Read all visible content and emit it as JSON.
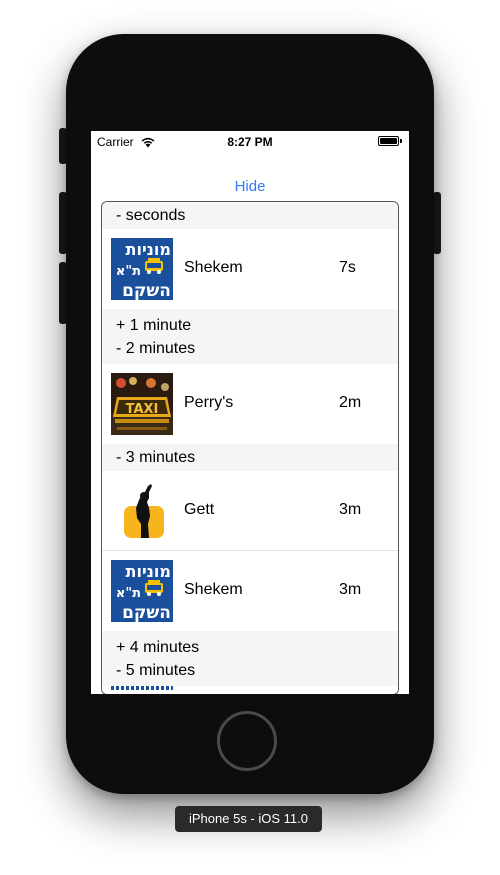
{
  "status_bar": {
    "carrier": "Carrier",
    "time": "8:27 PM",
    "icons": [
      "wifi-icon",
      "battery-icon"
    ]
  },
  "hide_button": "Hide",
  "colors": {
    "accent": "#3478f6",
    "section_bg": "#f5f5f5",
    "shekem_blue": "#1a4f9c",
    "gett_yellow": "#f6b51d"
  },
  "sections": [
    {
      "header": "- seconds",
      "expanded": true,
      "rows": [
        {
          "name": "Shekem",
          "time": "7s",
          "logo": "shekem-logo"
        }
      ]
    },
    {
      "header": "+ 1 minute",
      "expanded": false,
      "rows": []
    },
    {
      "header": "- 2 minutes",
      "expanded": true,
      "rows": [
        {
          "name": "Perry's",
          "time": "2m",
          "logo": "taxi-sign-logo"
        }
      ]
    },
    {
      "header": "- 3 minutes",
      "expanded": true,
      "rows": [
        {
          "name": "Gett",
          "time": "3m",
          "logo": "gett-logo"
        },
        {
          "name": "Shekem",
          "time": "3m",
          "logo": "shekem-logo"
        }
      ]
    },
    {
      "header": "+ 4 minutes",
      "expanded": false,
      "rows": []
    },
    {
      "header": "- 5 minutes",
      "expanded": true,
      "rows": []
    }
  ],
  "logo_text": {
    "shekem_line1": "מוניות",
    "shekem_line2": "ת\"א",
    "shekem_line3": "השקם",
    "taxi_sign": "TAXI"
  },
  "device_label": "iPhone 5s - iOS 11.0"
}
